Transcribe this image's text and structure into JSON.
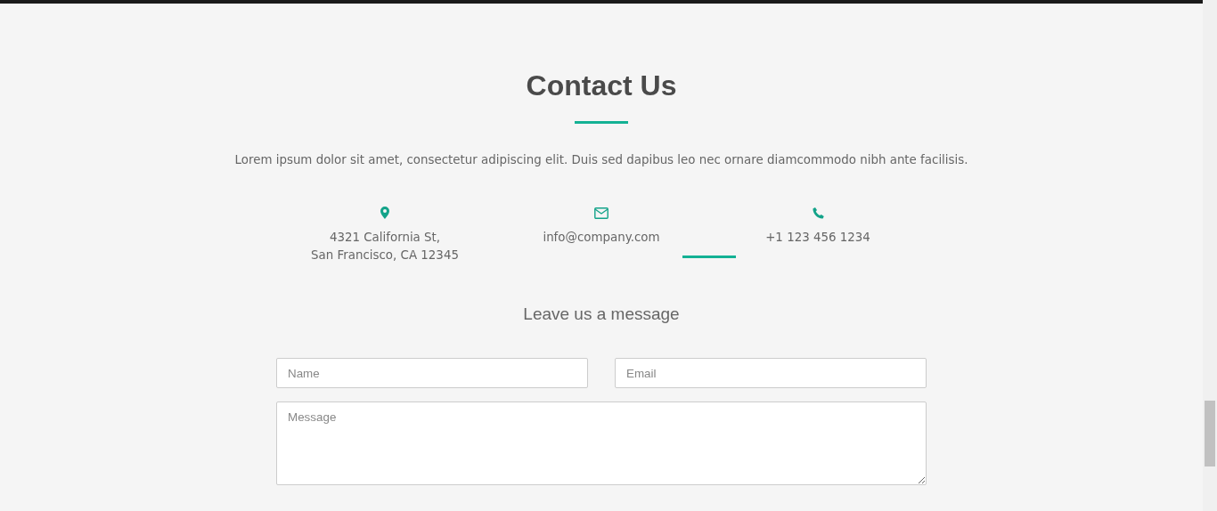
{
  "section": {
    "title": "Contact Us",
    "intro": "Lorem ipsum dolor sit amet, consectetur adipiscing elit. Duis sed dapibus leo nec ornare diamcommodo nibh ante facilisis."
  },
  "contact_items": [
    {
      "kind": "address",
      "lines": [
        "4321 California St,",
        "San Francisco, CA 12345"
      ]
    },
    {
      "kind": "email",
      "lines": [
        "info@company.com"
      ]
    },
    {
      "kind": "phone",
      "lines": [
        "+1 123 456 1234"
      ]
    }
  ],
  "form": {
    "heading": "Leave us a message",
    "fields": [
      {
        "kind": "input",
        "placeholder": "Name"
      },
      {
        "kind": "input",
        "placeholder": "Email"
      },
      {
        "kind": "textarea",
        "placeholder": "Message"
      }
    ]
  }
}
